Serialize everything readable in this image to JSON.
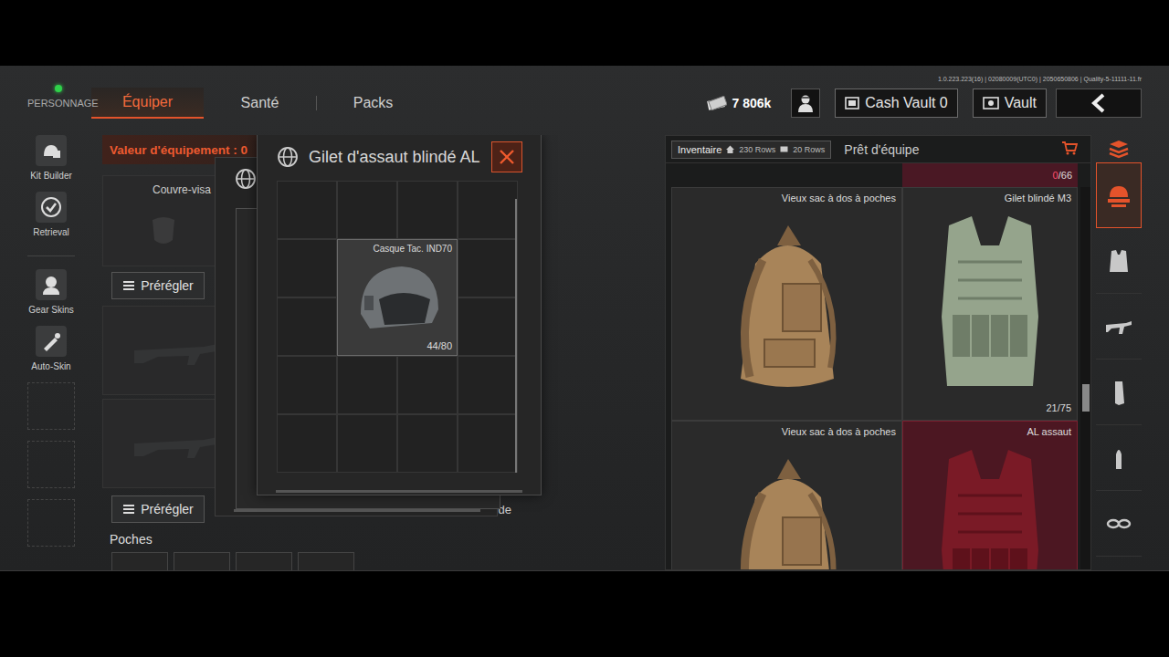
{
  "version": "1.0.223.223(16) | 02080009(UTC0) | 2050650806 | Quality-5-11111-11.fr",
  "character": {
    "label": "PERSONNAGE",
    "online": true
  },
  "tabs": [
    {
      "label": "Équiper",
      "selected": true
    },
    {
      "label": "Santé",
      "selected": false
    },
    {
      "label": "Packs",
      "selected": false
    }
  ],
  "currency": "7 806k",
  "cash_vault": "Cash Vault 0",
  "vault": "Vault",
  "sidebar": {
    "items": [
      {
        "label": "Kit Builder"
      },
      {
        "label": "Retrieval"
      },
      {
        "label": "Gear Skins"
      },
      {
        "label": "Auto-Skin"
      }
    ]
  },
  "loadout": {
    "value": "Valeur d'équipement : 0",
    "face_slot": "Couvre-visa",
    "presets": [
      "Prérégler",
      "Prérégler"
    ],
    "partial_label": "de",
    "pockets": "Poches"
  },
  "popup": {
    "title": "Gilet d'assaut blindé AL",
    "items": [
      {
        "name": "Casque Tac. IND70",
        "durability": "44/80"
      }
    ]
  },
  "inventory": {
    "tabs": [
      {
        "label": "Inventaire",
        "selected": true,
        "counts": [
          "230 Rows",
          "20 Rows"
        ]
      },
      {
        "label": "Prêt d'équipe",
        "selected": false
      }
    ],
    "capacity_used": "0",
    "capacity_total": "/66",
    "items": [
      {
        "name": "Vieux sac à dos à poches",
        "kind": "backpack",
        "highlighted": false
      },
      {
        "name": "Gilet blindé M3",
        "durability": "21/75",
        "kind": "vest",
        "highlighted": false
      },
      {
        "name": "Vieux sac à dos à poches",
        "kind": "backpack",
        "highlighted": false
      },
      {
        "name": "AL assaut",
        "kind": "vest",
        "highlighted": true
      }
    ]
  },
  "side_tabs": [
    {
      "kind": "gear",
      "selected": true
    },
    {
      "kind": "vest",
      "selected": false
    },
    {
      "kind": "rifle",
      "selected": false
    },
    {
      "kind": "magazine",
      "selected": false
    },
    {
      "kind": "bullet",
      "selected": false
    },
    {
      "kind": "misc",
      "selected": false
    }
  ]
}
